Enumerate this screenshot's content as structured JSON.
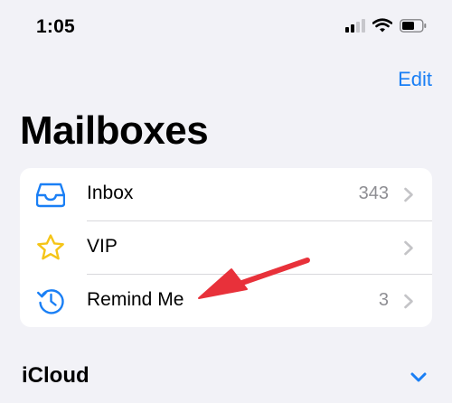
{
  "status_bar": {
    "time": "1:05"
  },
  "nav": {
    "edit_label": "Edit"
  },
  "page_title": "Mailboxes",
  "mailboxes": [
    {
      "label": "Inbox",
      "count": "343",
      "icon": "inbox-tray-icon"
    },
    {
      "label": "VIP",
      "count": "",
      "icon": "star-icon"
    },
    {
      "label": "Remind Me",
      "count": "3",
      "icon": "clock-history-icon"
    }
  ],
  "sections": [
    {
      "title": "iCloud",
      "icon": "chevron-down-icon"
    }
  ],
  "colors": {
    "accent": "#1a7ff5",
    "star": "#f5c518",
    "annotation": "#e8313a",
    "background": "#f2f2f7"
  }
}
